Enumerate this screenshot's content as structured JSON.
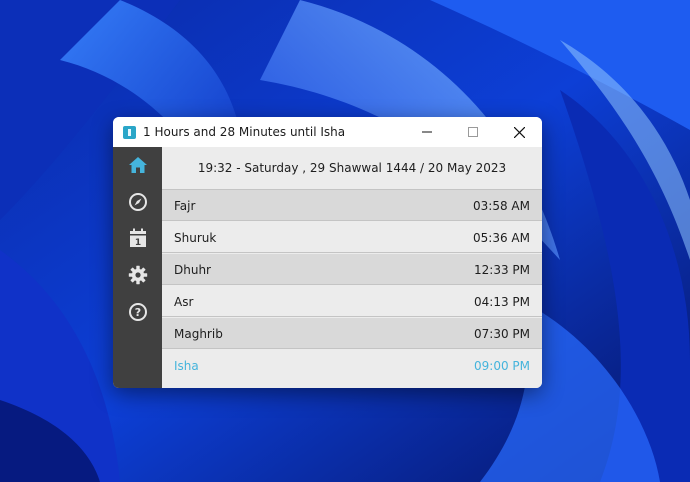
{
  "window": {
    "title": "1 Hours and 28 Minutes until Isha"
  },
  "sidebar": {
    "items": [
      {
        "name": "home",
        "icon": "home-icon",
        "active": true
      },
      {
        "name": "qibla",
        "icon": "compass-icon"
      },
      {
        "name": "calendar",
        "icon": "calendar-icon",
        "badge": "1"
      },
      {
        "name": "settings",
        "icon": "gear-icon"
      },
      {
        "name": "help",
        "icon": "help-icon",
        "badge": "?"
      }
    ]
  },
  "main": {
    "date_line": "19:32 - Saturday , 29 Shawwal 1444 / 20 May 2023",
    "prayers": [
      {
        "name": "Fajr",
        "time": "03:58 AM"
      },
      {
        "name": "Shuruk",
        "time": "05:36 AM"
      },
      {
        "name": "Dhuhr",
        "time": "12:33 PM"
      },
      {
        "name": "Asr",
        "time": "04:13 PM"
      },
      {
        "name": "Maghrib",
        "time": "07:30 PM"
      },
      {
        "name": "Isha",
        "time": "09:00 PM"
      }
    ]
  },
  "colors": {
    "accent": "#45b4dc",
    "sidebar_bg": "#404040",
    "row_dark": "#d9d9d9",
    "row_light": "#ececec"
  }
}
